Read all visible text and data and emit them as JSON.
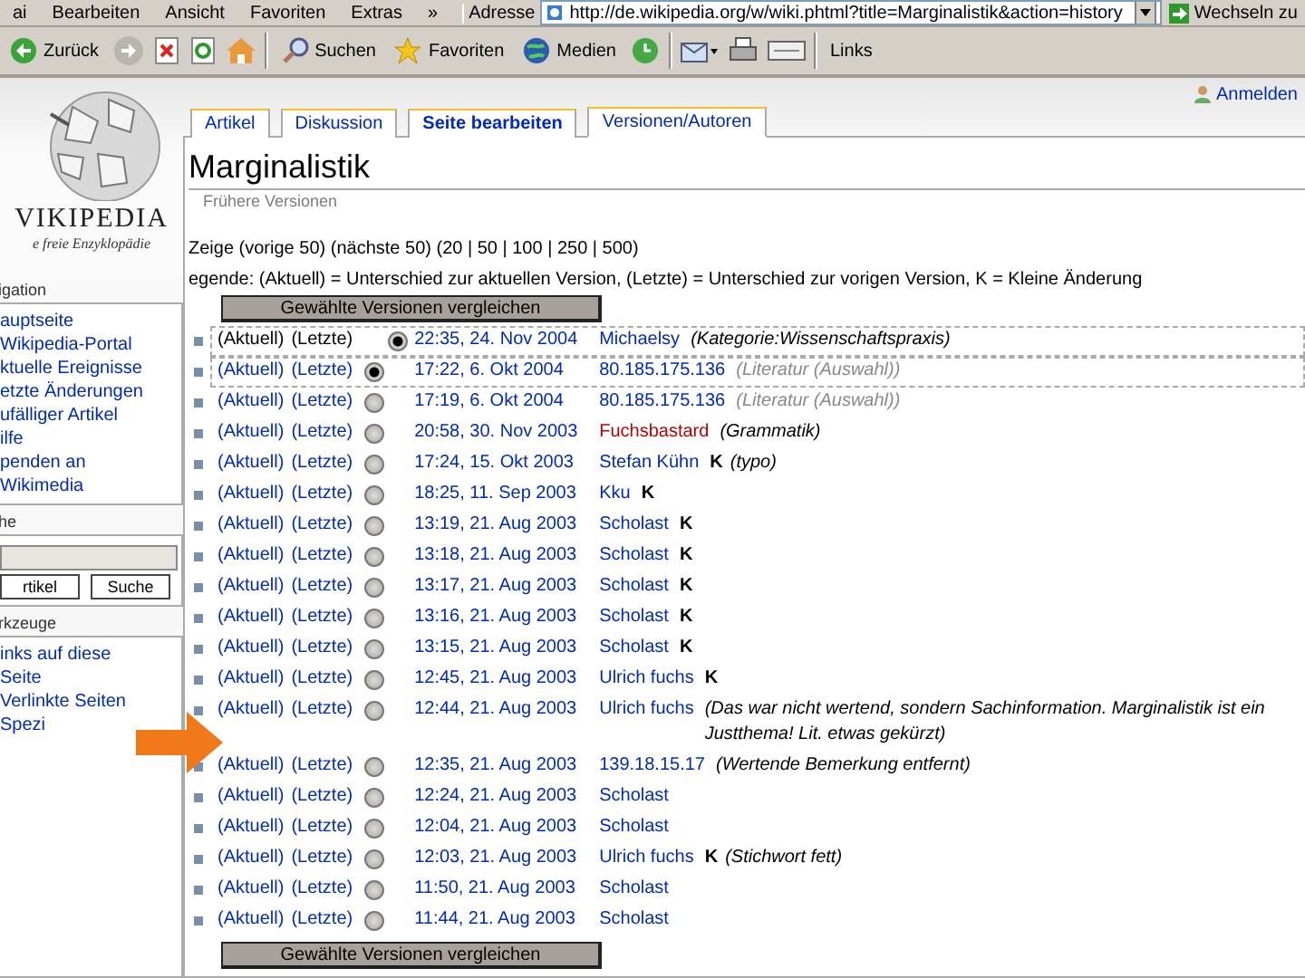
{
  "menu_bar": {
    "items": [
      "ai",
      "Bearbeiten",
      "Ansicht",
      "Favoriten",
      "Extras",
      "»"
    ],
    "address_label": "Adresse",
    "address": "http://de.wikipedia.org/w/wiki.phtml?title=Marginalistik&action=history",
    "go_label": "Wechseln zu"
  },
  "toolbar": {
    "back": "Zurück",
    "search": "Suchen",
    "favorites": "Favoriten",
    "media": "Medien",
    "links": "Links"
  },
  "logo": {
    "wordmark": "VIKIPEDIA",
    "tagline": "e freie Enzyklopädie"
  },
  "sidebar": {
    "navigation": {
      "heading": "igation",
      "items": [
        "auptseite",
        "Wikipedia-Portal",
        "ktuelle Ereignisse",
        "etzte Änderungen",
        "ufälliger Artikel",
        "ilfe",
        "penden an",
        "Wikimedia"
      ]
    },
    "search": {
      "heading": "he",
      "buttons": [
        "rtikel",
        "Suche"
      ]
    },
    "tools": {
      "heading": "rkzeuge",
      "items": [
        "inks auf diese",
        "Seite",
        "Verlinkte Seiten",
        "Spezi"
      ]
    }
  },
  "user_link": "Anmelden",
  "tabs": [
    {
      "label": "Artikel",
      "selected": false
    },
    {
      "label": "Diskussion",
      "selected": false
    },
    {
      "label": "Seite bearbeiten",
      "selected": false
    },
    {
      "label": "Versionen/Autoren",
      "selected": true
    }
  ],
  "title": "Marginalistik",
  "subtitle": "Frühere Versionen",
  "paging": "Zeige (vorige 50) (nächste 50) (20 | 50 | 100 | 250 | 500)",
  "legend": "egende: (Aktuell) = Unterschied zur aktuellen Version, (Letzte) = Unterschied zur vorigen Version, K = Kleine Änderung",
  "compare_buttons": [
    "Gewählte Versionen vergleichen",
    "Gewählte Versionen vergleichen"
  ],
  "rows": [
    {
      "kind": "current",
      "selected": true,
      "cur": "(Aktuell)",
      "last": "(Letzte)",
      "time": "22:35, 24. Nov 2004",
      "user": "Michaelsy",
      "user_redlink": false,
      "minor": false,
      "comment": "(Kategorie:Wissenschaftspraxis)",
      "comment_section": false
    },
    {
      "kind": "older",
      "selected": true,
      "cur": "(Aktuell)",
      "last": "(Letzte)",
      "time": "17:22, 6. Okt 2004",
      "user": "80.185.175.136",
      "user_redlink": false,
      "minor": false,
      "comment": "(Literatur (Auswahl))",
      "comment_section": true
    },
    {
      "kind": "older",
      "selected": false,
      "cur": "(Aktuell)",
      "last": "(Letzte)",
      "time": "17:19, 6. Okt 2004",
      "user": "80.185.175.136",
      "user_redlink": false,
      "minor": false,
      "comment": "(Literatur (Auswahl))",
      "comment_section": true
    },
    {
      "kind": "older",
      "selected": false,
      "cur": "(Aktuell)",
      "last": "(Letzte)",
      "time": "20:58, 30. Nov 2003",
      "user": "Fuchsbastard",
      "user_redlink": true,
      "minor": false,
      "comment": "(Grammatik)",
      "comment_section": false
    },
    {
      "kind": "older",
      "selected": false,
      "cur": "(Aktuell)",
      "last": "(Letzte)",
      "time": "17:24, 15. Okt 2003",
      "user": "Stefan Kühn",
      "user_redlink": false,
      "minor": true,
      "minor_label": "K",
      "comment": "(typo)",
      "comment_section": false
    },
    {
      "kind": "older",
      "selected": false,
      "cur": "(Aktuell)",
      "last": "(Letzte)",
      "time": "18:25, 11. Sep 2003",
      "user": "Kku",
      "user_redlink": false,
      "minor": true,
      "minor_label": "K"
    },
    {
      "kind": "older",
      "selected": false,
      "cur": "(Aktuell)",
      "last": "(Letzte)",
      "time": "13:19, 21. Aug 2003",
      "user": "Scholast",
      "user_redlink": false,
      "minor": true,
      "minor_label": "K"
    },
    {
      "kind": "older",
      "selected": false,
      "cur": "(Aktuell)",
      "last": "(Letzte)",
      "time": "13:18, 21. Aug 2003",
      "user": "Scholast",
      "user_redlink": false,
      "minor": true,
      "minor_label": "K"
    },
    {
      "kind": "older",
      "selected": false,
      "cur": "(Aktuell)",
      "last": "(Letzte)",
      "time": "13:17, 21. Aug 2003",
      "user": "Scholast",
      "user_redlink": false,
      "minor": true,
      "minor_label": "K"
    },
    {
      "kind": "older",
      "selected": false,
      "cur": "(Aktuell)",
      "last": "(Letzte)",
      "time": "13:16, 21. Aug 2003",
      "user": "Scholast",
      "user_redlink": false,
      "minor": true,
      "minor_label": "K"
    },
    {
      "kind": "older",
      "selected": false,
      "cur": "(Aktuell)",
      "last": "(Letzte)",
      "time": "13:15, 21. Aug 2003",
      "user": "Scholast",
      "user_redlink": false,
      "minor": true,
      "minor_label": "K"
    },
    {
      "kind": "older",
      "selected": false,
      "cur": "(Aktuell)",
      "last": "(Letzte)",
      "time": "12:45, 21. Aug 2003",
      "user": "Ulrich fuchs",
      "user_redlink": false,
      "minor": true,
      "minor_label": "K"
    },
    {
      "kind": "older",
      "selected": false,
      "cur": "(Aktuell)",
      "last": "(Letzte)",
      "time": "12:44, 21. Aug 2003",
      "user": "Ulrich fuchs",
      "user_redlink": false,
      "minor": false,
      "comment": "(Das war nicht wertend, sondern Sachinformation. Marginalistik ist ein Justthema! Lit. etwas gekürzt)",
      "comment_section": false
    },
    {
      "kind": "older",
      "selected": false,
      "cur": "(Aktuell)",
      "last": "(Letzte)",
      "time": "12:35, 21. Aug 2003",
      "user": "139.18.15.17",
      "user_redlink": false,
      "minor": false,
      "comment": "(Wertende Bemerkung entfernt)",
      "comment_section": false
    },
    {
      "kind": "older",
      "selected": false,
      "cur": "(Aktuell)",
      "last": "(Letzte)",
      "time": "12:24, 21. Aug 2003",
      "user": "Scholast",
      "user_redlink": false,
      "minor": false
    },
    {
      "kind": "older",
      "selected": false,
      "cur": "(Aktuell)",
      "last": "(Letzte)",
      "time": "12:04, 21. Aug 2003",
      "user": "Scholast",
      "user_redlink": false,
      "minor": false
    },
    {
      "kind": "older",
      "selected": false,
      "cur": "(Aktuell)",
      "last": "(Letzte)",
      "time": "12:03, 21. Aug 2003",
      "user": "Ulrich fuchs",
      "user_redlink": false,
      "minor": true,
      "minor_label": "K",
      "comment": "(Stichwort fett)",
      "comment_section": false
    },
    {
      "kind": "older",
      "selected": false,
      "cur": "(Aktuell)",
      "last": "(Letzte)",
      "time": "11:50, 21. Aug 2003",
      "user": "Scholast",
      "user_redlink": false,
      "minor": false
    },
    {
      "kind": "older",
      "selected": false,
      "cur": "(Aktuell)",
      "last": "(Letzte)",
      "time": "11:44, 21. Aug 2003",
      "user": "Scholast",
      "user_redlink": false,
      "minor": false
    }
  ]
}
